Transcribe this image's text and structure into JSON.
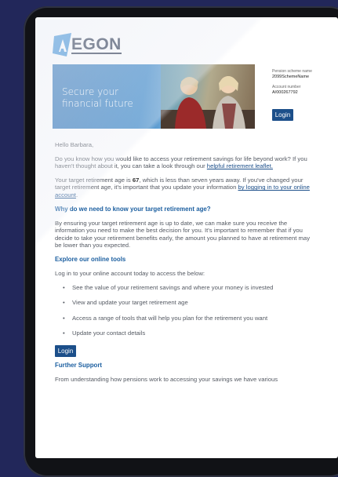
{
  "brand": {
    "logo_text": "EGON"
  },
  "hero": {
    "line1": "Secure your",
    "line2": "financial future"
  },
  "account": {
    "scheme_label": "Pension scheme name",
    "scheme_value": "2099SchemeName",
    "number_label": "Account number",
    "number_value": "A/000267792",
    "login_label": "Login"
  },
  "email": {
    "greeting": "Hello Barbara,",
    "intro": "Do you know how you would like to access your retirement savings for life beyond work? If you haven't thought about it, you can take a look through our ",
    "intro_link": "helpful retirement leaflet.",
    "target_pre": "Your target retirement age is ",
    "target_age": "67",
    "target_post": ", which is less than seven years away. If you've changed your target retirement age, it's important that you update your information ",
    "target_link": "by logging in to your online account",
    "target_end": ".",
    "why_heading": "Why do we need to know your target retirement age?",
    "why_body": "By ensuring your target retirement age is up to date, we can make sure you receive the information you need to make the best decision for you. It's important to remember that if you decide to take your retirement benefits early, the amount you planned to have at retirement may be lower than you expected.",
    "tools_heading": "Explore our online tools",
    "tools_intro": "Log in to your online account today to access the below:",
    "tools_items": [
      "See the value of your retirement savings and where your money is invested",
      "View and update your target retirement age",
      "Access a range of tools that will help you plan for the retirement you want",
      "Update your contact details"
    ],
    "login_label": "Login",
    "support_heading": "Further Support",
    "support_body": "From understanding how pensions work to accessing your savings we have various"
  },
  "colors": {
    "brand_blue": "#1c4f8a",
    "heading_blue": "#1c5fa0",
    "background": "#22275a"
  }
}
